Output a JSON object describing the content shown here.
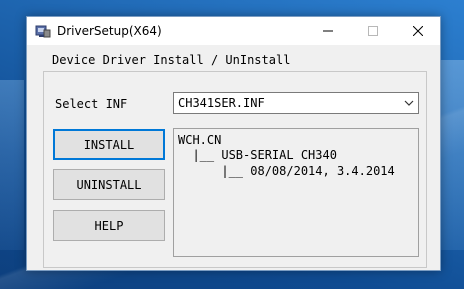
{
  "window": {
    "title": "DriverSetup(X64)",
    "app_icon": "setup-icon",
    "minimize_icon": "minimize-icon",
    "maximize_icon": "maximize-icon",
    "close_icon": "close-icon"
  },
  "group": {
    "title": "Device Driver Install / UnInstall"
  },
  "select_inf": {
    "label": "Select INF",
    "value": "CH341SER.INF"
  },
  "buttons": {
    "install": "INSTALL",
    "uninstall": "UNINSTALL",
    "help": "HELP"
  },
  "info": {
    "lines": [
      "WCH.CN",
      "  |__ USB-SERIAL CH340",
      "      |__ 08/08/2014, 3.4.2014"
    ]
  },
  "colors": {
    "focus_border": "#0078d7",
    "client_bg": "#f0f0f0",
    "desktop": "#1d63ad"
  }
}
